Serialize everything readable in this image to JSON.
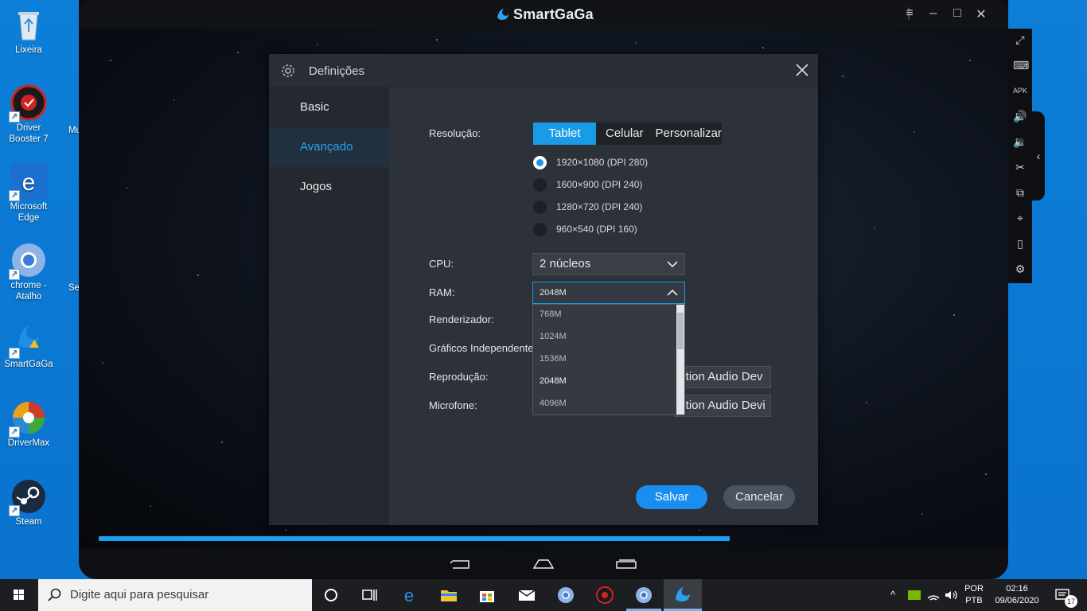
{
  "desktop": {
    "icons": [
      {
        "label": "Lixeira"
      },
      {
        "label": "Driver Booster 7"
      },
      {
        "label": "Microsoft Edge"
      },
      {
        "label": "chrome - Atalho"
      },
      {
        "label": "SmartGaGa"
      },
      {
        "label": "DriverMax"
      },
      {
        "label": "Steam"
      }
    ],
    "partial_labels": [
      "Mu",
      "Se"
    ]
  },
  "emulator": {
    "title": "SmartGaGa",
    "colors": {
      "accent": "#1a9be6",
      "progress": "#1c9ff0"
    },
    "progress_fraction": 0.69,
    "sidebar_icons": [
      "fullscreen-icon",
      "keyboard-icon",
      "apk-install-icon",
      "volume-up-icon",
      "volume-down-icon",
      "screenshot-icon",
      "multi-instance-icon",
      "location-icon",
      "shake-icon",
      "settings-icon"
    ]
  },
  "dialog": {
    "title": "Definições",
    "tabs": [
      {
        "label": "Basic"
      },
      {
        "label": "Avançado"
      },
      {
        "label": "Jogos"
      }
    ],
    "resolution": {
      "label": "Resolução:",
      "modes": [
        "Tablet",
        "Celular",
        "Personalizar"
      ],
      "options": [
        "1920×1080 (DPI 280)",
        "1600×900 (DPI 240)",
        "1280×720 (DPI 240)",
        "960×540 (DPI 160)"
      ]
    },
    "cpu": {
      "label": "CPU:",
      "value": "2 núcleos"
    },
    "ram": {
      "label": "RAM:",
      "value": "2048M",
      "options": [
        "768M",
        "1024M",
        "1536M",
        "2048M",
        "4096M"
      ]
    },
    "renderer": {
      "label": "Renderizador:"
    },
    "graphics": {
      "label": "Gráficos Independentes"
    },
    "playback": {
      "label": "Reprodução:",
      "value": "nition Audio Dev"
    },
    "microphone": {
      "label": "Microfone:",
      "value": "nition Audio Devi"
    },
    "save_label": "Salvar",
    "cancel_label": "Cancelar"
  },
  "taskbar": {
    "search_placeholder": "Digite aqui para pesquisar",
    "lang_top": "POR",
    "lang_bottom": "PTB",
    "time": "02:16",
    "date": "09/06/2020",
    "notifications": "17"
  }
}
